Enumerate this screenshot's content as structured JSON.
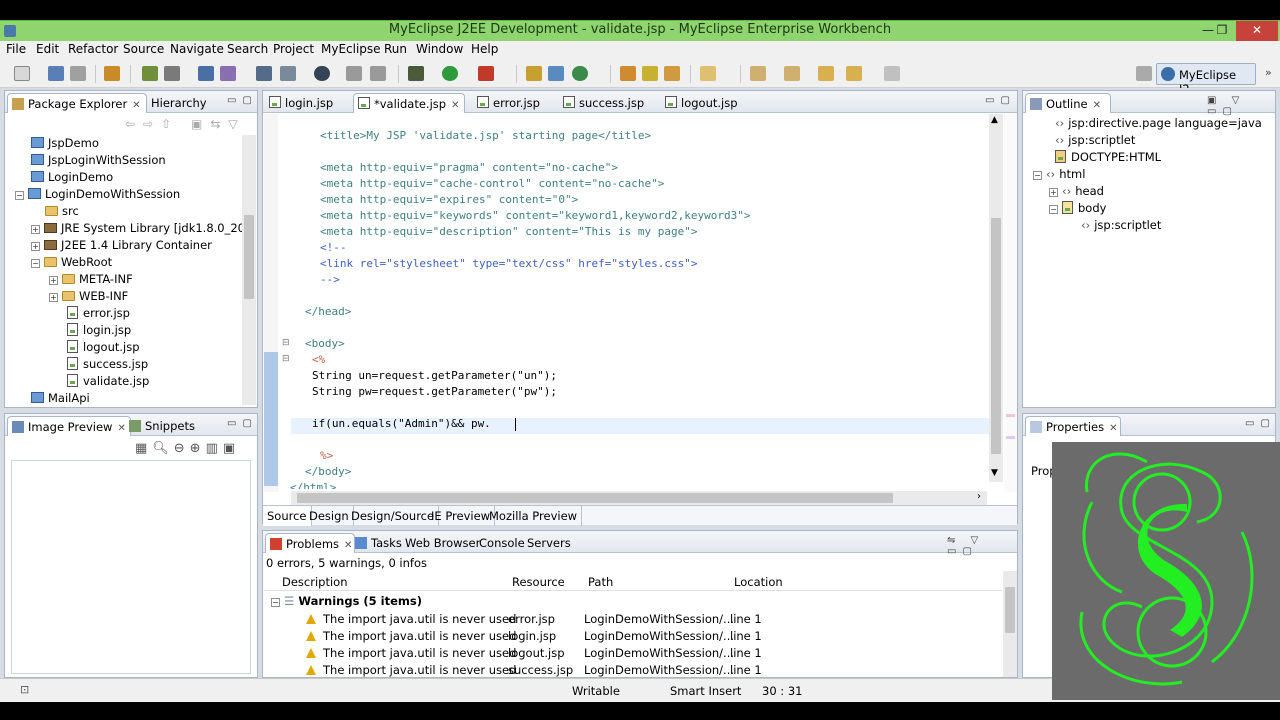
{
  "window": {
    "title": "MyEclipse J2EE Development - validate.jsp - MyEclipse Enterprise Workbench",
    "minimize": "—",
    "maximize": "❐",
    "close": "✕"
  },
  "menu": [
    "File",
    "Edit",
    "Refactor",
    "Source",
    "Navigate",
    "Search",
    "Project",
    "MyEclipse",
    "Run",
    "Window",
    "Help"
  ],
  "perspective": {
    "label": "MyEclipse J2..."
  },
  "package_explorer": {
    "tabs": [
      "Package Explorer",
      "Hierarchy"
    ],
    "items": [
      {
        "label": "JspDemo"
      },
      {
        "label": "JspLoginWithSession"
      },
      {
        "label": "LoginDemo"
      },
      {
        "label": "LoginDemoWithSession"
      },
      {
        "label": "src"
      },
      {
        "label": "JRE System Library [jdk1.8.0_20]"
      },
      {
        "label": "J2EE 1.4 Library Container"
      },
      {
        "label": "WebRoot"
      },
      {
        "label": "META-INF"
      },
      {
        "label": "WEB-INF"
      },
      {
        "label": "error.jsp"
      },
      {
        "label": "login.jsp"
      },
      {
        "label": "logout.jsp"
      },
      {
        "label": "success.jsp"
      },
      {
        "label": "validate.jsp"
      },
      {
        "label": "MailApi"
      }
    ]
  },
  "image_preview": {
    "tabs": [
      "Image Preview",
      "Snippets"
    ]
  },
  "editor": {
    "tabs": [
      "login.jsp",
      "*validate.jsp",
      "error.jsp",
      "success.jsp",
      "logout.jsp"
    ],
    "bottom_tabs": [
      "Source",
      "Design",
      "Design/Source",
      "IE Preview",
      "Mozilla Preview"
    ]
  },
  "code_lines": [
    "<title>My JSP 'validate.jsp' starting page</title>",
    "<meta http-equiv=\"pragma\" content=\"no-cache\">",
    "<meta http-equiv=\"cache-control\" content=\"no-cache\">",
    "<meta http-equiv=\"expires\" content=\"0\">",
    "<meta http-equiv=\"keywords\" content=\"keyword1,keyword2,keyword3\">",
    "<meta http-equiv=\"description\" content=\"This is my page\">",
    "<!--",
    "<link rel=\"stylesheet\" type=\"text/css\" href=\"styles.css\">",
    "-->",
    "</head>",
    "<body>",
    "<%",
    "String un=request.getParameter(\"un\");",
    "String pw=request.getParameter(\"pw\");",
    "if(un.equals(\"Admin\")&& pw.",
    "%>",
    "</body>",
    "</html>"
  ],
  "outline": {
    "tab": "Outline",
    "items": [
      "jsp:directive.page language=java",
      "jsp:scriptlet",
      "DOCTYPE:HTML",
      "html",
      "head",
      "body",
      "jsp:scriptlet"
    ]
  },
  "properties": {
    "tab": "Properties",
    "label": "Prop"
  },
  "problems": {
    "tabs": [
      "Problems",
      "Tasks",
      "Web Browser",
      "Console",
      "Servers"
    ],
    "summary": "0 errors, 5 warnings, 0 infos",
    "columns": [
      "Description",
      "Resource",
      "Path",
      "Location"
    ],
    "group": "Warnings (5 items)",
    "rows": [
      {
        "description": "The import java.util is never used",
        "resource": "error.jsp",
        "path": "LoginDemoWithSession/...",
        "location": "line 1"
      },
      {
        "description": "The import java.util is never used",
        "resource": "login.jsp",
        "path": "LoginDemoWithSession/...",
        "location": "line 1"
      },
      {
        "description": "The import java.util is never used",
        "resource": "logout.jsp",
        "path": "LoginDemoWithSession/...",
        "location": "line 1"
      },
      {
        "description": "The import java.util is never used",
        "resource": "success.jsp",
        "path": "LoginDemoWithSession/...",
        "location": "line 1"
      }
    ]
  },
  "status": {
    "writable": "Writable",
    "insert": "Smart Insert",
    "position": "30 : 31"
  },
  "colors": {
    "titlebar": "#8fd46e",
    "logo_green": "#22ee22",
    "logo_bg": "#6b6b6b"
  }
}
